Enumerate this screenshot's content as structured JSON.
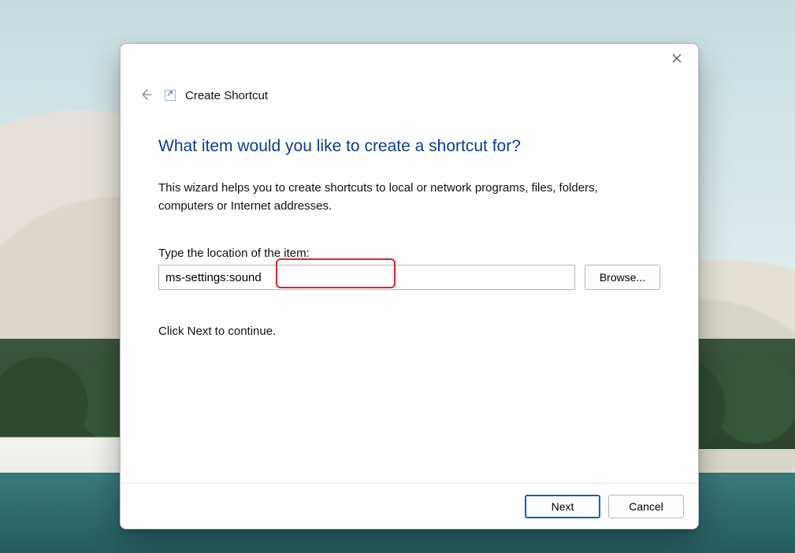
{
  "window": {
    "title": "Create Shortcut"
  },
  "content": {
    "heading": "What item would you like to create a shortcut for?",
    "intro": "This wizard helps you to create shortcuts to local or network programs, files, folders, computers or Internet addresses.",
    "location_label": "Type the location of the item:",
    "location_value": "ms-settings:sound",
    "browse_label": "Browse...",
    "continue_hint": "Click Next to continue."
  },
  "footer": {
    "next_label": "Next",
    "cancel_label": "Cancel"
  }
}
